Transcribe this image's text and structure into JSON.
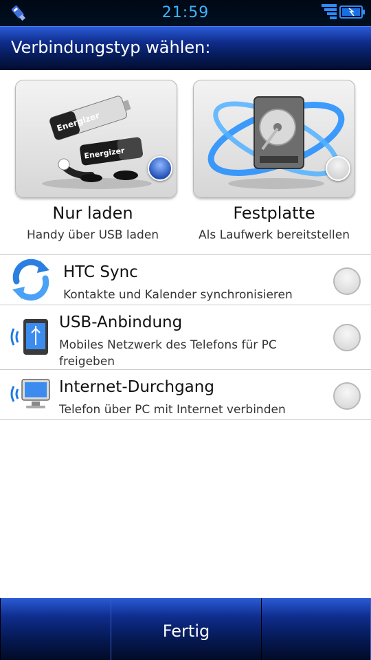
{
  "status_bar": {
    "time": "21:59",
    "left_icon": "usb-icon",
    "right_icons": [
      "signal-icon",
      "battery-icon"
    ],
    "accent_color": "#3fb4ff"
  },
  "header": {
    "title": "Verbindungstyp wählen:"
  },
  "options": {
    "charge": {
      "title": "Nur laden",
      "subtitle": "Handy über USB laden",
      "selected": true,
      "icon": "battery-character-icon"
    },
    "disk": {
      "title": "Festplatte",
      "subtitle": "Als Laufwerk bereitstellen",
      "selected": false,
      "icon": "hard-disk-icon"
    }
  },
  "list": [
    {
      "title": "HTC Sync",
      "subtitle": "Kontakte und Kalender synchronisieren",
      "selected": false,
      "icon": "sync-icon"
    },
    {
      "title": "USB-Anbindung",
      "subtitle": "Mobiles Netzwerk des Telefons für PC freigeben",
      "selected": false,
      "icon": "usb-tethering-icon"
    },
    {
      "title": "Internet-Durchgang",
      "subtitle": "Telefon über PC mit Internet verbinden",
      "selected": false,
      "icon": "internet-passthrough-icon"
    }
  ],
  "footer": {
    "done_label": "Fertig"
  },
  "colors": {
    "bar_blue": "#0f2d8c",
    "selected_radio": "#2552b8"
  }
}
